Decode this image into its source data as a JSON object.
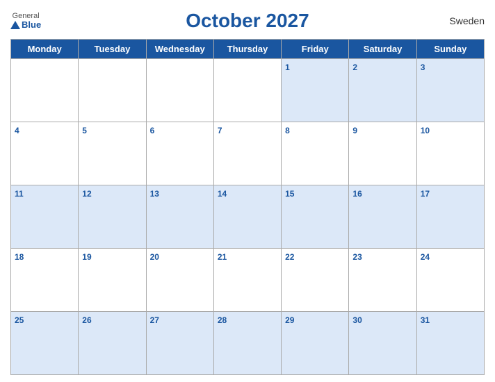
{
  "header": {
    "logo_general": "General",
    "logo_blue": "Blue",
    "title": "October 2027",
    "country": "Sweden"
  },
  "weekdays": [
    "Monday",
    "Tuesday",
    "Wednesday",
    "Thursday",
    "Friday",
    "Saturday",
    "Sunday"
  ],
  "weeks": [
    [
      null,
      null,
      null,
      null,
      1,
      2,
      3
    ],
    [
      4,
      5,
      6,
      7,
      8,
      9,
      10
    ],
    [
      11,
      12,
      13,
      14,
      15,
      16,
      17
    ],
    [
      18,
      19,
      20,
      21,
      22,
      23,
      24
    ],
    [
      25,
      26,
      27,
      28,
      29,
      30,
      31
    ]
  ]
}
